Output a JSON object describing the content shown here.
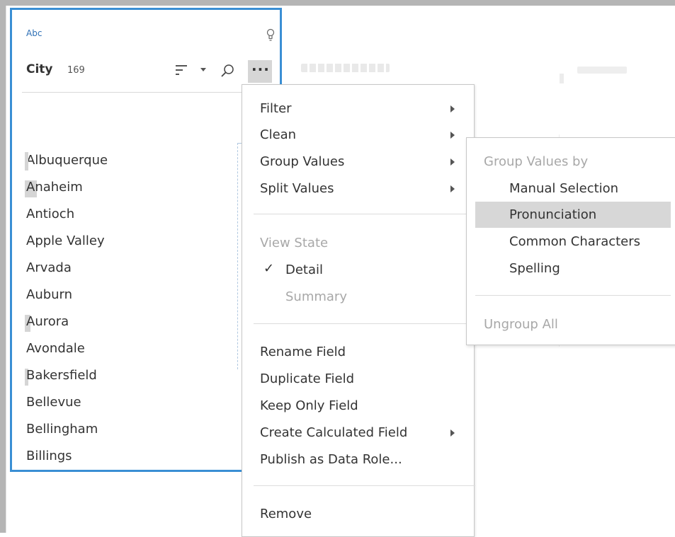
{
  "card": {
    "type_label": "Abc",
    "field_name": "City",
    "field_count": "169",
    "more_label": "···",
    "cities": [
      "Albuquerque",
      "Anaheim",
      "Antioch",
      "Apple Valley",
      "Arvada",
      "Auburn",
      "Aurora",
      "Avondale",
      "Bakersfield",
      "Bellevue",
      "Bellingham",
      "Billings"
    ]
  },
  "menu": {
    "filter": "Filter",
    "clean": "Clean",
    "group_values": "Group Values",
    "split_values": "Split Values",
    "view_state": "View State",
    "check": "✓",
    "detail": "Detail",
    "summary": "Summary",
    "rename_field": "Rename Field",
    "duplicate_field": "Duplicate Field",
    "keep_only_field": "Keep Only Field",
    "create_calculated_field": "Create Calculated Field",
    "publish_as_data_role": "Publish as Data Role...",
    "remove": "Remove"
  },
  "submenu": {
    "header": "Group Values by",
    "manual_selection": "Manual Selection",
    "pronunciation": "Pronunciation",
    "common_characters": "Common Characters",
    "spelling": "Spelling",
    "ungroup_all": "Ungroup All"
  },
  "colors": {
    "card_border": "#3a8fd4",
    "type_label": "#2d6fb5",
    "highlight": "#d7d7d7",
    "disabled_text": "#a8a8a8"
  }
}
